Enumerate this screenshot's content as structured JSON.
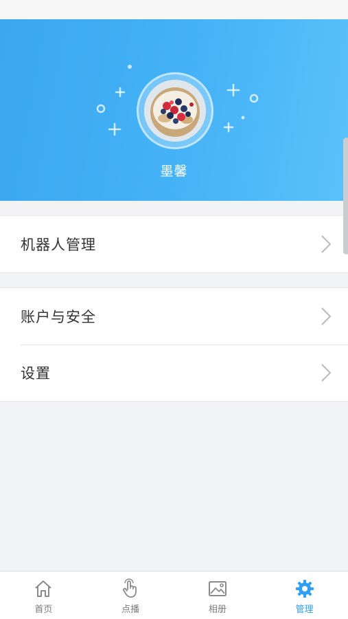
{
  "profile": {
    "username": "墨馨"
  },
  "menu": {
    "group1": [
      {
        "label": "机器人管理"
      }
    ],
    "group2": [
      {
        "label": "账户与安全"
      },
      {
        "label": "设置"
      }
    ]
  },
  "tabbar": {
    "active": "管理",
    "items": [
      {
        "label": "首页",
        "icon": "home-icon"
      },
      {
        "label": "点播",
        "icon": "tap-hand-icon"
      },
      {
        "label": "相册",
        "icon": "picture-icon"
      },
      {
        "label": "管理",
        "icon": "gear-icon"
      }
    ]
  },
  "colors": {
    "header_blue": "#45b3f6",
    "active_tab": "#2f9ff0",
    "background": "#f2f3f5"
  }
}
